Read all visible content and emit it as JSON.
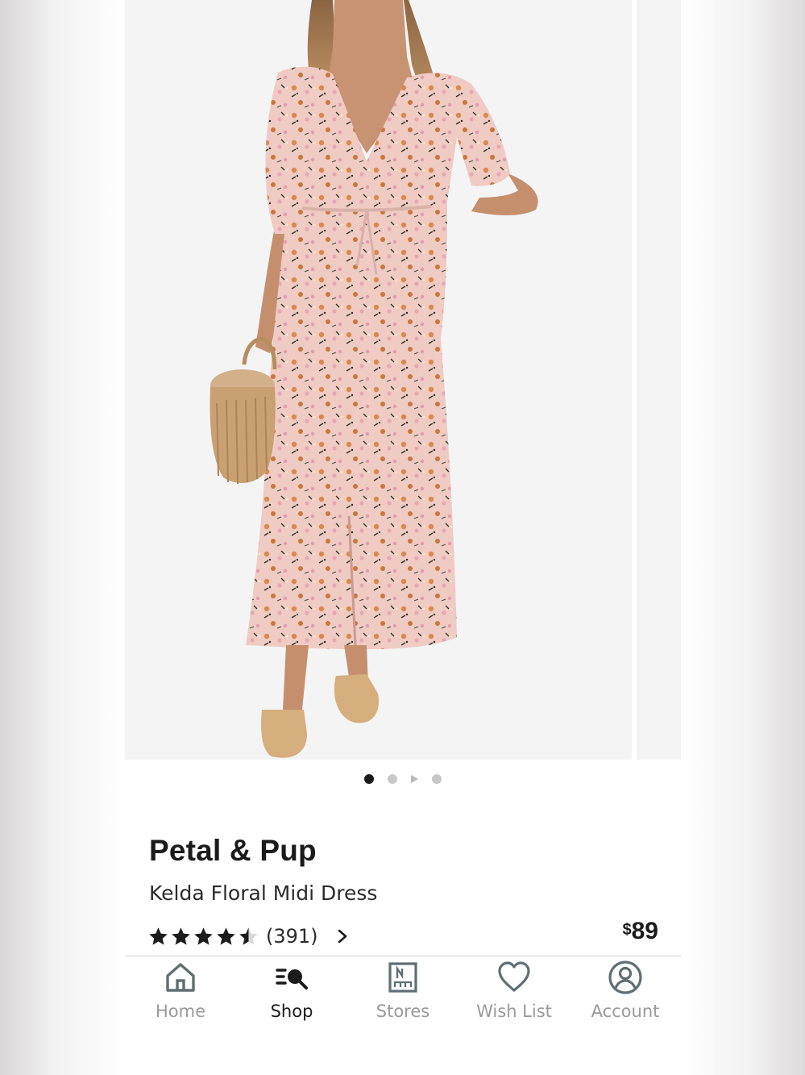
{
  "product": {
    "brand": "Petal & Pup",
    "name": "Kelda Floral Midi Dress",
    "rating": 4.5,
    "rating_max": 5,
    "review_count": "(391)",
    "price_currency": "$",
    "price_amount": "89"
  },
  "carousel": {
    "image_count": 4,
    "active_index": 0,
    "indicators": [
      "image",
      "image",
      "video",
      "image"
    ]
  },
  "tabbar": {
    "items": [
      {
        "label": "Home",
        "icon": "home-icon",
        "active": false
      },
      {
        "label": "Shop",
        "icon": "shop-search-icon",
        "active": true
      },
      {
        "label": "Stores",
        "icon": "store-icon",
        "active": false
      },
      {
        "label": "Wish List",
        "icon": "heart-icon",
        "active": false
      },
      {
        "label": "Account",
        "icon": "account-icon",
        "active": false
      }
    ]
  },
  "colors": {
    "text_primary": "#1b1b1b",
    "text_muted": "#9a9a9a",
    "image_background": "#f4f4f5",
    "dress_base": "#eec9c3",
    "dress_flower_orange": "#d98a4f",
    "dress_flower_pink": "#e6a6b3"
  }
}
